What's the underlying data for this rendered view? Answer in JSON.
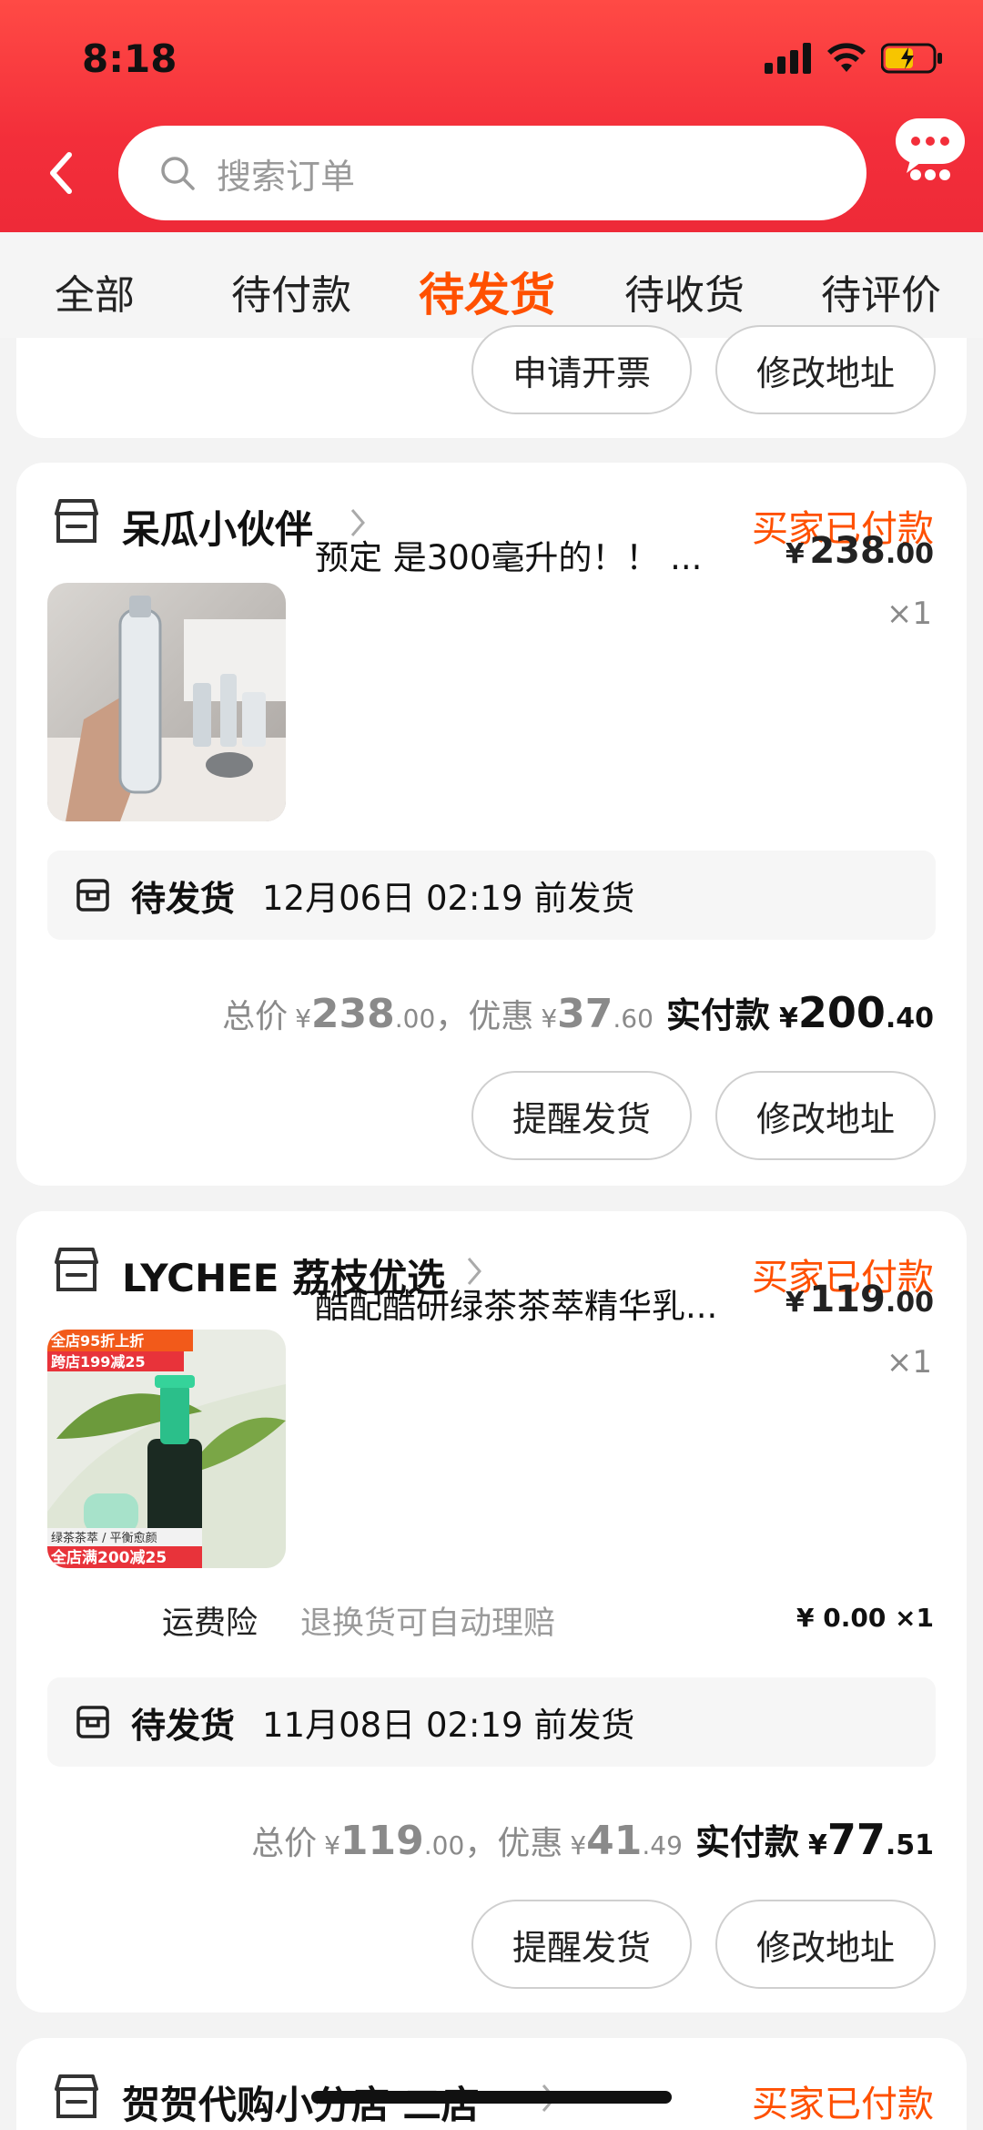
{
  "status_bar": {
    "time": "8:18"
  },
  "search": {
    "placeholder": "搜索订单"
  },
  "tabs": [
    {
      "label": "全部",
      "active": false
    },
    {
      "label": "待付款",
      "active": false
    },
    {
      "label": "待发货",
      "active": true
    },
    {
      "label": "待收货",
      "active": false
    },
    {
      "label": "待评价",
      "active": false
    }
  ],
  "partial_card": {
    "buttons": [
      "申请开票",
      "修改地址"
    ]
  },
  "orders": [
    {
      "shop_name": "呆瓜小伙伴",
      "status": "买家已付款",
      "item_title": "预定 是300毫升的！！ ...",
      "price_currency": "¥",
      "price_int": "238",
      "price_dec": ".00",
      "quantity": "×1",
      "ship_label": "待发货",
      "ship_deadline": "12月06日 02:19 前发货",
      "totals": {
        "total_label": "总价",
        "total_int": "238",
        "total_dec": ".00",
        "sep": "，",
        "discount_label": "优惠",
        "discount_int": "37",
        "discount_dec": ".60",
        "paid_label": "实付款",
        "paid_int": "200",
        "paid_dec": ".40"
      },
      "buttons": [
        "提醒发货",
        "修改地址"
      ]
    },
    {
      "shop_name": "LYCHEE 荔枝优选",
      "status": "买家已付款",
      "item_title": "酷配酷研绿茶茶萃精华乳...",
      "price_currency": "¥",
      "price_int": "119",
      "price_dec": ".00",
      "quantity": "×1",
      "insurance": {
        "label": "运费险",
        "desc": "退换货可自动理赔",
        "price": "¥ 0.00 ×1"
      },
      "thumb_banners": {
        "top1": "全店95折上折",
        "top2": "跨店199减25",
        "bottom1": "绿茶茶萃 / 平衡愈颜",
        "bottom2": "全店满200减25"
      },
      "ship_label": "待发货",
      "ship_deadline": "11月08日 02:19 前发货",
      "totals": {
        "total_label": "总价",
        "total_int": "119",
        "total_dec": ".00",
        "sep": "，",
        "discount_label": "优惠",
        "discount_int": "41",
        "discount_dec": ".49",
        "paid_label": "实付款",
        "paid_int": "77",
        "paid_dec": ".51"
      },
      "buttons": [
        "提醒发货",
        "修改地址"
      ]
    },
    {
      "shop_name": "贺贺代购小分店 二店",
      "status": "买家已付款"
    }
  ],
  "colors": {
    "accent": "#ff5000",
    "header": "#f32e3a"
  }
}
